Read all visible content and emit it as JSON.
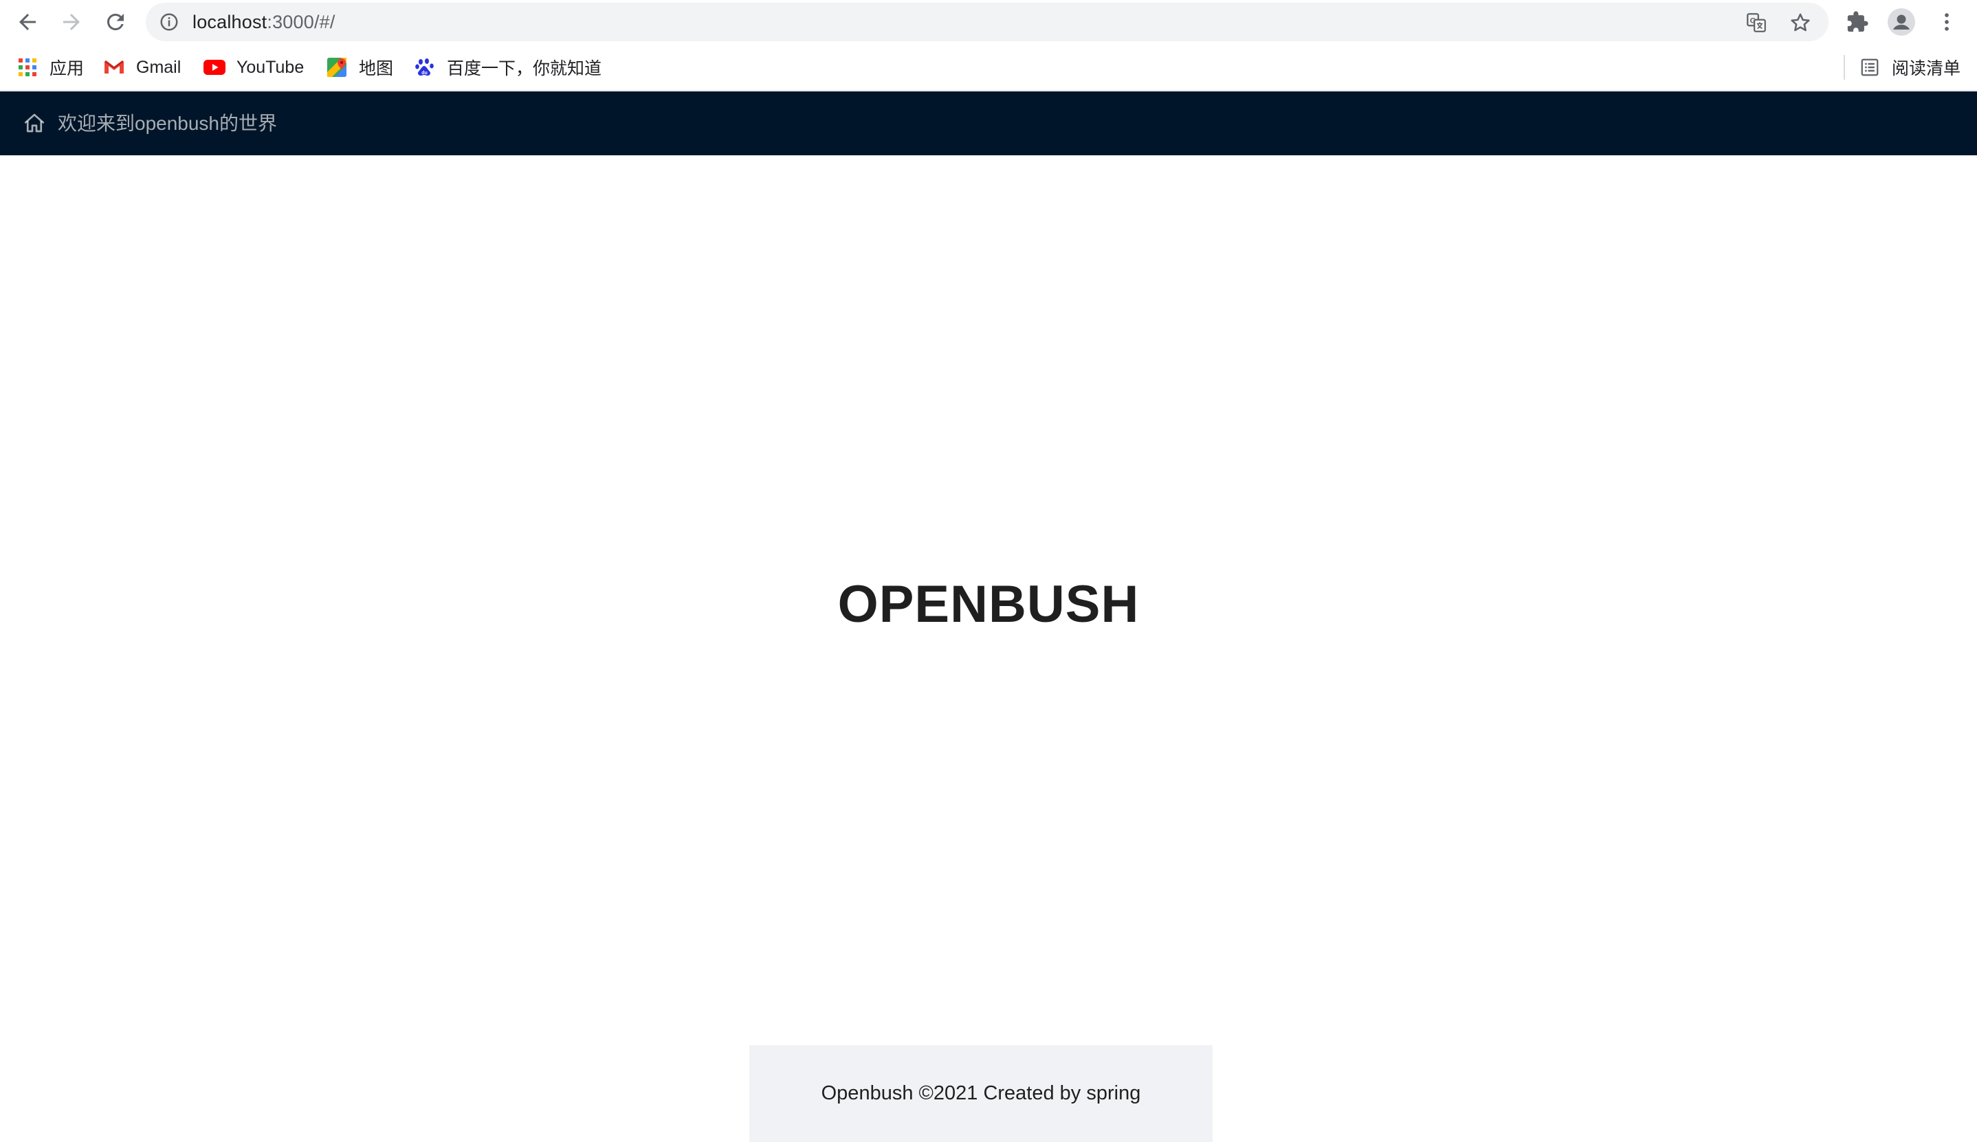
{
  "browser": {
    "url_host": "localhost",
    "url_rest": ":3000/#/",
    "bookmarks": [
      {
        "label": "应用",
        "icon": "apps-grid-icon"
      },
      {
        "label": "Gmail",
        "icon": "gmail-icon"
      },
      {
        "label": "YouTube",
        "icon": "youtube-icon"
      },
      {
        "label": "地图",
        "icon": "maps-icon"
      },
      {
        "label": "百度一下，你就知道",
        "icon": "baidu-paw-icon"
      }
    ],
    "reading_list_label": "阅读清单"
  },
  "header": {
    "welcome_text": "欢迎来到openbush的世界",
    "background": "#001529"
  },
  "main": {
    "title": "OPENBUSH"
  },
  "footer": {
    "text": "Openbush ©2021 Created by spring",
    "background": "#f0f2f5"
  }
}
